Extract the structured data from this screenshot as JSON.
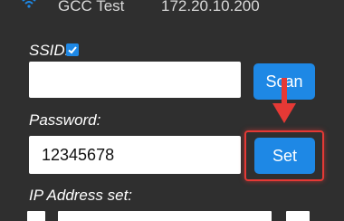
{
  "header": {
    "ssid_name": "GCC Test",
    "ip_address": "172.20.10.200"
  },
  "form": {
    "ssid_label": "SSID:",
    "ssid_checked": true,
    "ssid_value": "",
    "scan_label": "Scan",
    "password_label": "Password:",
    "password_value": "12345678",
    "set_label": "Set",
    "ip_label": "IP Address set:"
  },
  "annotation": {
    "arrow_color": "#e53935",
    "box_color": "#e53935"
  },
  "colors": {
    "background": "#2f2f2f",
    "accent": "#1e88e5"
  }
}
